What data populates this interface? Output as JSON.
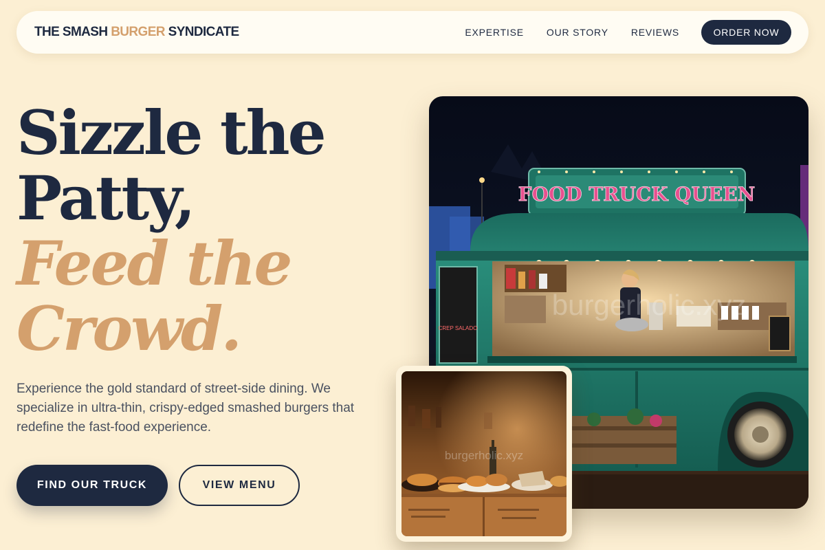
{
  "brand": {
    "part1": "THE SMASH ",
    "accent": "BURGER",
    "part2": " SYNDICATE"
  },
  "nav": {
    "links": [
      "EXPERTISE",
      "OUR STORY",
      "REVIEWS"
    ],
    "cta": "ORDER NOW"
  },
  "hero": {
    "line1": "Sizzle the",
    "line2": "Patty,",
    "line3": "Feed the",
    "line4": "Crowd.",
    "lead": "Experience the gold standard of street-side dining. We specialize in ultra-thin, crispy-edged smashed burgers that redefine the fast-food experience.",
    "primary_button": "FIND OUR TRUCK",
    "secondary_button": "VIEW MENU"
  },
  "truck_image": {
    "sign": "FOOD TRUCK QUEEN",
    "watermark": "burgerholic.xyz",
    "menu_board": "CREP SALADO"
  },
  "food_image": {
    "watermark": "burgerholic.xyz"
  },
  "colors": {
    "background": "#fcefd3",
    "navy": "#1e2940",
    "gold": "#d4a06d",
    "truck_green": "#1f7a6a"
  }
}
